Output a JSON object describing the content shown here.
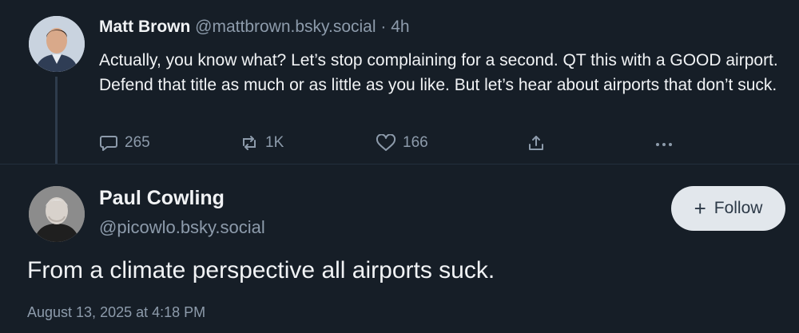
{
  "parent_post": {
    "author_name": "Matt Brown",
    "author_handle": "@mattbrown.bsky.social",
    "separator": "·",
    "time": "4h",
    "text": "Actually, you know what? Let’s stop complaining for a second. QT this with a GOOD airport. Defend that title as much or as little as you like. But let’s hear about airports that don’t suck.",
    "reply_count": "265",
    "repost_count": "1K",
    "like_count": "166"
  },
  "main_post": {
    "author_name": "Paul Cowling",
    "author_handle": "@picowlo.bsky.social",
    "follow_label": "Follow",
    "text": "From a climate perspective all airports suck.",
    "date": "August 13, 2025 at 4:18 PM"
  },
  "icons": {
    "reply": "reply-icon",
    "repost": "repost-icon",
    "like": "heart-icon",
    "share": "share-icon",
    "more": "more-icon",
    "follow": "plus-icon"
  },
  "colors": {
    "background": "#161e27",
    "text": "#f1f3f5",
    "muted": "#8d9bab",
    "follow_button": "#e2e7ec"
  }
}
